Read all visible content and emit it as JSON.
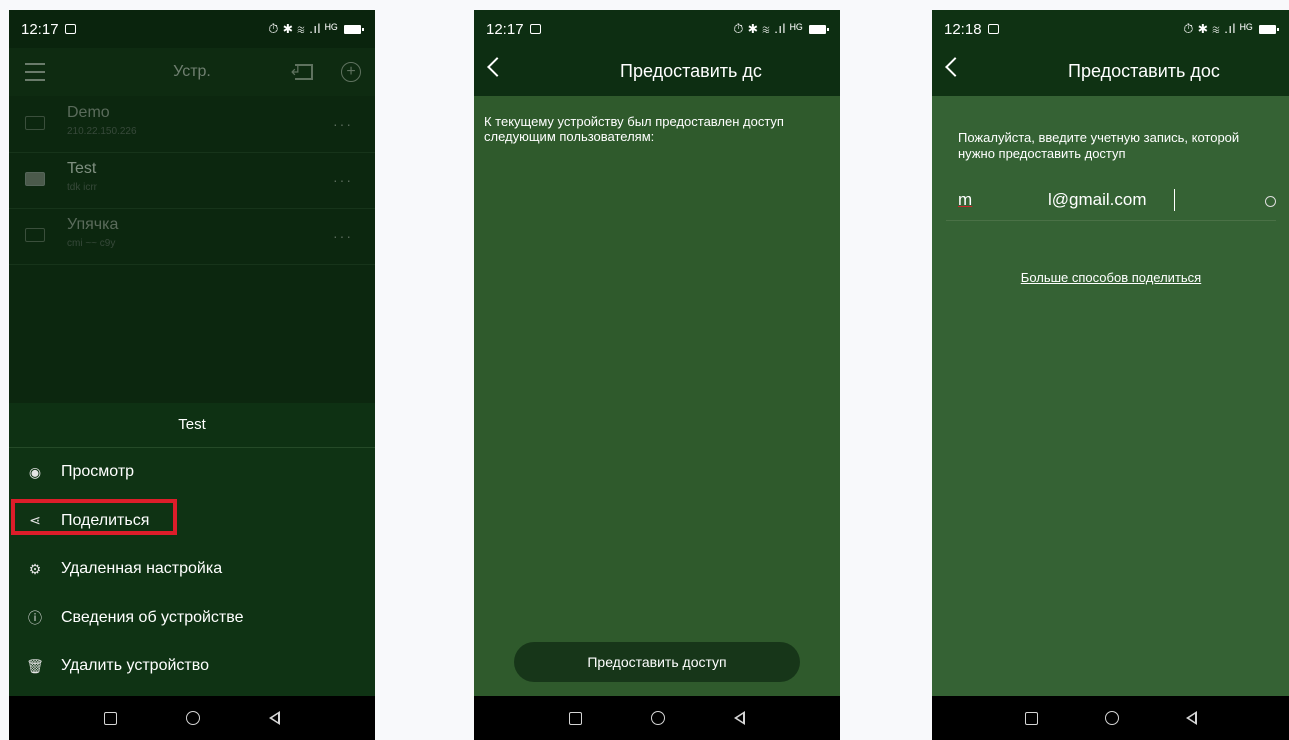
{
  "phone1": {
    "status": {
      "time": "12:17",
      "icons": "⏱ ✱ ≋ .ıl ᴴᴳ"
    },
    "title": "Устр.",
    "devices": [
      {
        "name": "Demo",
        "sub": "210.22.150.226",
        "more": "···"
      },
      {
        "name": "Test",
        "sub": "tdk           icrr",
        "more": "···"
      },
      {
        "name": "Упячка",
        "sub": "cmi     ~~   c9y",
        "more": "···"
      }
    ],
    "sheet_title": "Test",
    "menu": [
      {
        "icon": "eye-icon",
        "glyph": "◉",
        "label": "Просмотр"
      },
      {
        "icon": "share-icon",
        "glyph": "⋖",
        "label": "Поделиться"
      },
      {
        "icon": "settings-icon",
        "glyph": "⚙",
        "label": "Удаленная настройка"
      },
      {
        "icon": "info-icon",
        "glyph": "ⓘ",
        "label": "Сведения об устройстве"
      },
      {
        "icon": "trash-icon",
        "glyph": "🗑",
        "label": "Удалить устройство"
      }
    ],
    "highlight_color": "#dd1d2a"
  },
  "phone2": {
    "status": {
      "time": "12:17",
      "icons": "⏱ ✱ ≋ .ıl ᴴᴳ"
    },
    "title": "Предоставить дс",
    "body": "К текущему устройству был предоставлен доступ следующим пользователям:",
    "button": "Предоставить доступ"
  },
  "phone3": {
    "status": {
      "time": "12:18",
      "icons": "⏱ ✱ ≋ .ıl ᴴᴳ"
    },
    "title": "Предоставить дос",
    "body": "Пожалуйста, введите учетную запись, которой нужно предоставить доступ",
    "input_prefix": "m",
    "input_value": "l@gmail.com",
    "link": "Больше способов поделиться"
  },
  "colors": {
    "app_dark": "#0c270f",
    "app_green": "#356234",
    "button": "#173619"
  }
}
